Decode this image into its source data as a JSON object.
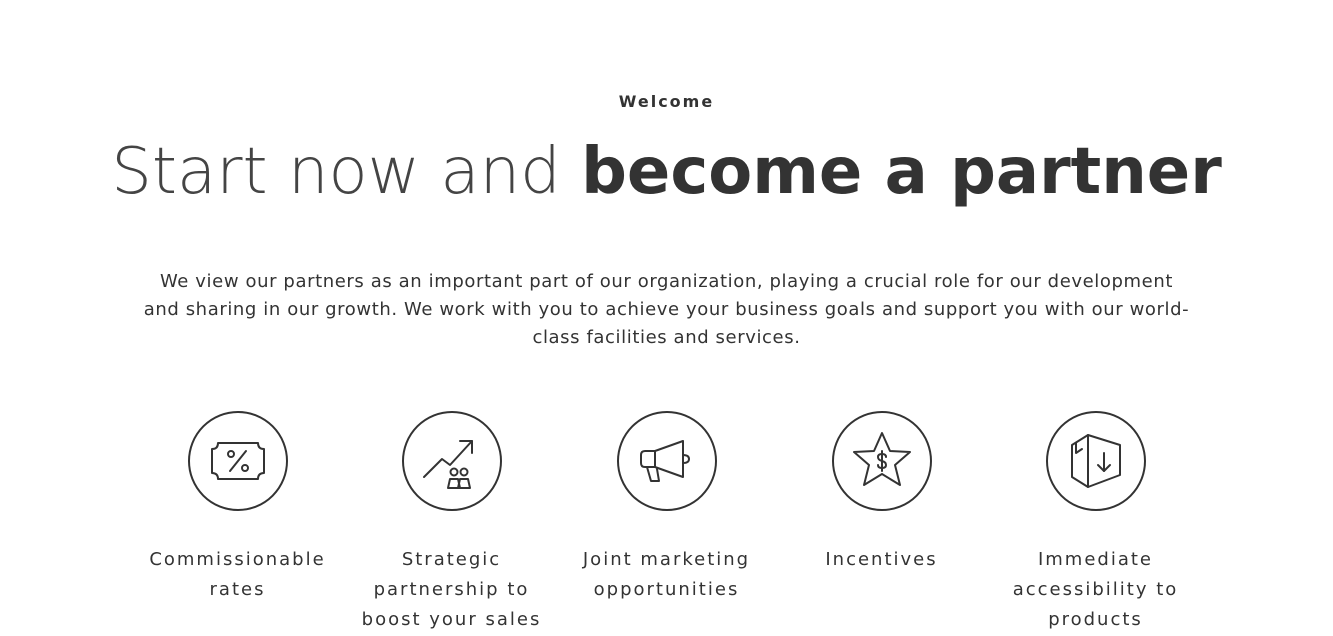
{
  "section": {
    "eyebrow": "Welcome",
    "headline_light": "Start now and ",
    "headline_bold": "become a partner",
    "intro": "We view our partners as an important part of our organization, playing a crucial role for our development and sharing in our growth. We work with you to achieve your business goals and support you with our world-class facilities and services."
  },
  "features": [
    {
      "icon": "ticket-percent-icon",
      "label": "Commissionable rates"
    },
    {
      "icon": "growth-chart-people-icon",
      "label": "Strategic partnership to boost your sales"
    },
    {
      "icon": "megaphone-icon",
      "label": "Joint marketing opportunities"
    },
    {
      "icon": "star-dollar-icon",
      "label": "Incentives"
    },
    {
      "icon": "box-download-icon",
      "label": "Immediate accessibility to products"
    }
  ],
  "colors": {
    "text": "#333333",
    "background": "#ffffff"
  }
}
